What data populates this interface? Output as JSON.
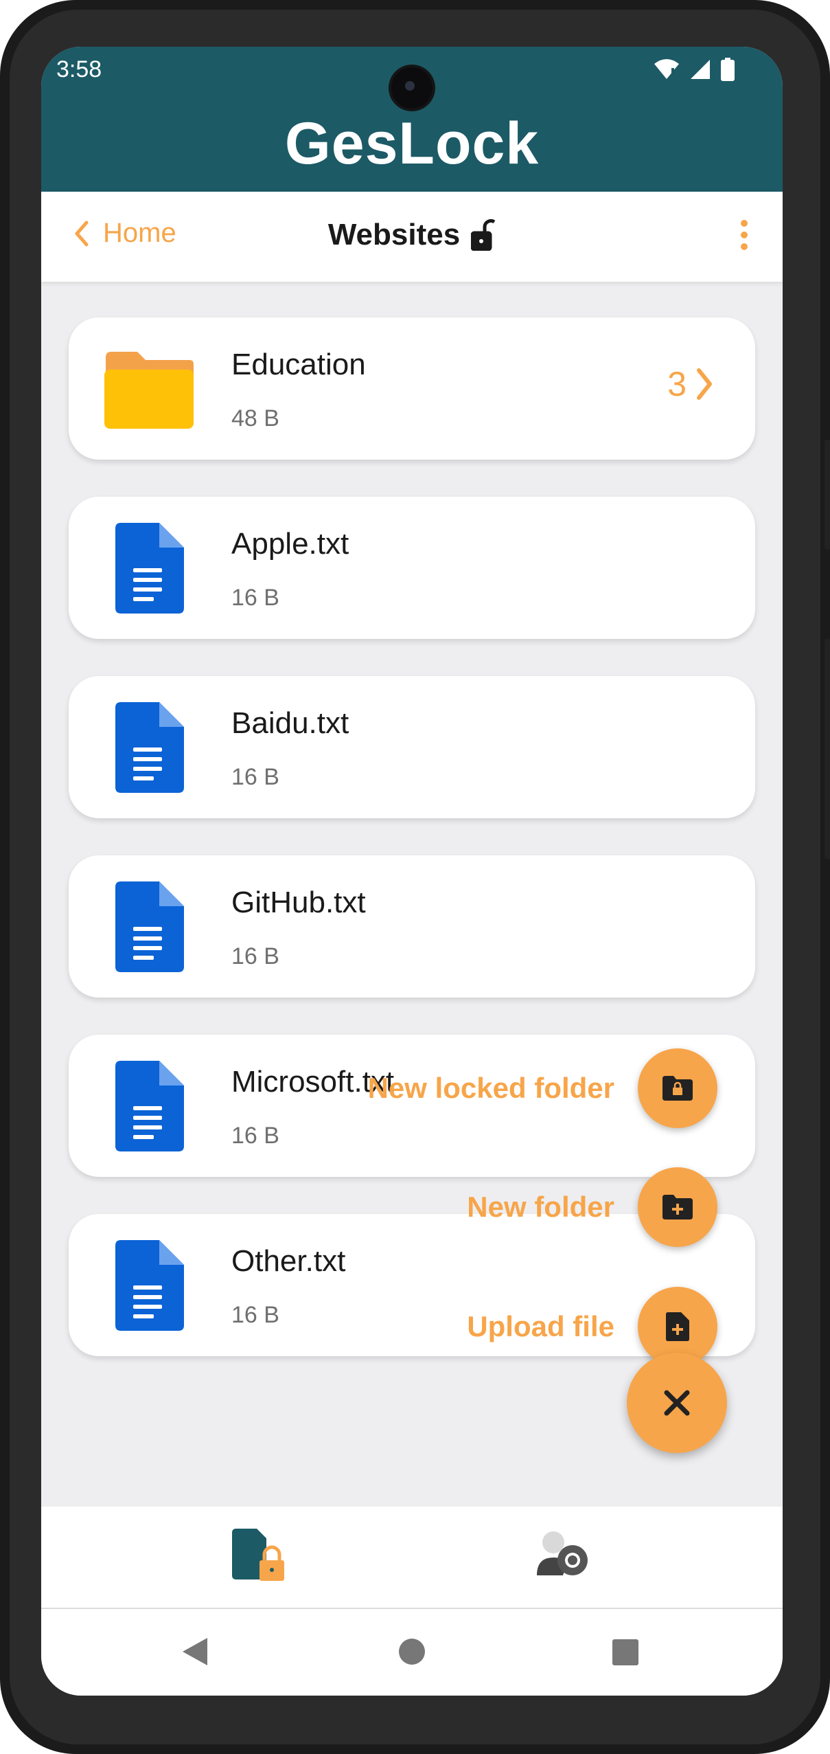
{
  "status_bar": {
    "time": "3:58"
  },
  "app": {
    "title": "GesLock"
  },
  "toolbar": {
    "back_label": "Home",
    "title": "Websites"
  },
  "items": [
    {
      "type": "folder",
      "name": "Education",
      "size": "48 B",
      "count": "3"
    },
    {
      "type": "file",
      "name": "Apple.txt",
      "size": "16 B"
    },
    {
      "type": "file",
      "name": "Baidu.txt",
      "size": "16 B"
    },
    {
      "type": "file",
      "name": "GitHub.txt",
      "size": "16 B"
    },
    {
      "type": "file",
      "name": "Microsoft.txt",
      "size": "16 B"
    },
    {
      "type": "file",
      "name": "Other.txt",
      "size": "16 B"
    }
  ],
  "fab_menu": {
    "new_locked_folder": "New locked folder",
    "new_folder": "New folder",
    "upload_file": "Upload file"
  },
  "bottom_nav": [
    {
      "icon": "locked-files-icon",
      "active": true
    },
    {
      "icon": "user-settings-icon",
      "active": false
    }
  ],
  "colors": {
    "header": "#1c5a66",
    "accent": "#f7a54a",
    "file_icon": "#0b63d6",
    "folder_icon": "#ffc107",
    "background": "#eeeef0"
  }
}
